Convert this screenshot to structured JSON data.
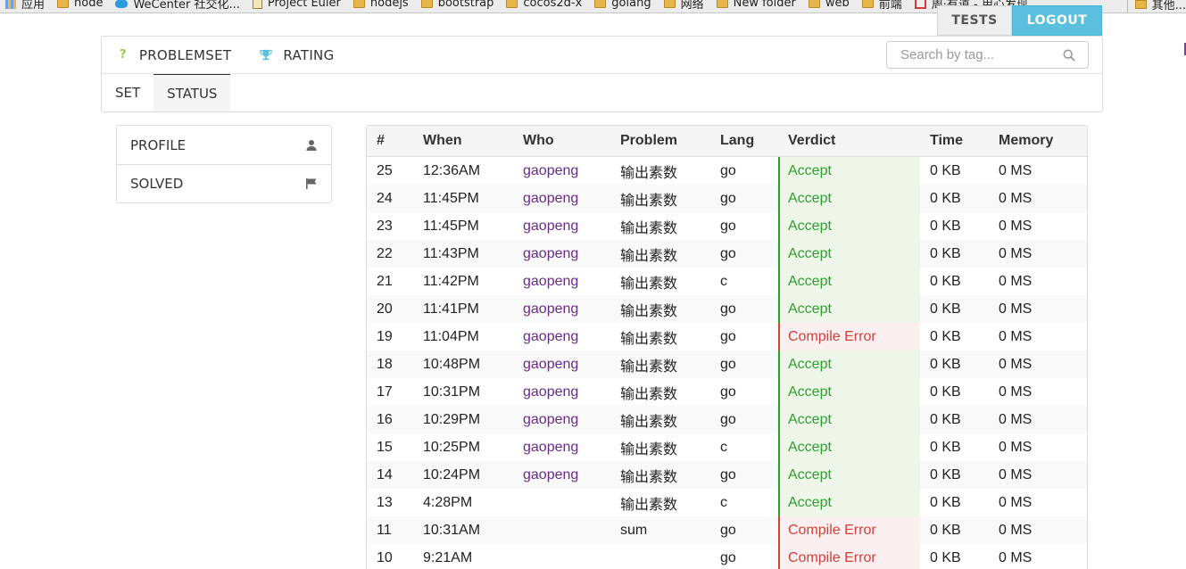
{
  "bookmarks": {
    "items": [
      {
        "label": "应用",
        "icon": "apps-grid-icon"
      },
      {
        "label": "node",
        "icon": "folder-icon"
      },
      {
        "label": "WeCenter 社交化...",
        "icon": "bird-icon"
      },
      {
        "label": "Project Euler",
        "icon": "page-icon"
      },
      {
        "label": "nodejs",
        "icon": "folder-icon"
      },
      {
        "label": "bootstrap",
        "icon": "folder-icon"
      },
      {
        "label": "cocos2d-x",
        "icon": "folder-icon"
      },
      {
        "label": "golang",
        "icon": "folder-icon"
      },
      {
        "label": "网络",
        "icon": "folder-icon"
      },
      {
        "label": "New folder",
        "icon": "folder-icon"
      },
      {
        "label": "web",
        "icon": "folder-icon"
      },
      {
        "label": "前端",
        "icon": "folder-icon"
      },
      {
        "label": "周·有道 - 用心发现...",
        "icon": "red-square-icon"
      }
    ],
    "more": "»",
    "other": "其他..."
  },
  "header": {
    "tests_label": "TESTS",
    "logout_label": "LOGOUT"
  },
  "nav": {
    "problemset_label": "PROBLEMSET",
    "problemset_icon": "question-icon",
    "rating_label": "RATING",
    "rating_icon": "trophy-icon",
    "search_placeholder": "Search by tag...",
    "sub": {
      "set_label": "SET",
      "status_label": "STATUS"
    }
  },
  "sidebar": {
    "profile_label": "PROFILE",
    "profile_icon": "user-icon",
    "solved_label": "SOLVED",
    "solved_icon": "flag-icon"
  },
  "colors": {
    "accept": "#2f9e2f",
    "error": "#d43f3a",
    "logout": "#5bc0de",
    "user": "#6a2a8a"
  },
  "table": {
    "headers": [
      "#",
      "When",
      "Who",
      "Problem",
      "Lang",
      "Verdict",
      "Time",
      "Memory"
    ],
    "rows": [
      {
        "id": "25",
        "when": "12:36AM",
        "who": "gaopeng",
        "problem": "输出素数",
        "lang": "go",
        "verdict": "Accept",
        "status": "ok",
        "time": "0 KB",
        "memory": "0 MS"
      },
      {
        "id": "24",
        "when": "11:45PM",
        "who": "gaopeng",
        "problem": "输出素数",
        "lang": "go",
        "verdict": "Accept",
        "status": "ok",
        "time": "0 KB",
        "memory": "0 MS"
      },
      {
        "id": "23",
        "when": "11:45PM",
        "who": "gaopeng",
        "problem": "输出素数",
        "lang": "go",
        "verdict": "Accept",
        "status": "ok",
        "time": "0 KB",
        "memory": "0 MS"
      },
      {
        "id": "22",
        "when": "11:43PM",
        "who": "gaopeng",
        "problem": "输出素数",
        "lang": "go",
        "verdict": "Accept",
        "status": "ok",
        "time": "0 KB",
        "memory": "0 MS"
      },
      {
        "id": "21",
        "when": "11:42PM",
        "who": "gaopeng",
        "problem": "输出素数",
        "lang": "c",
        "verdict": "Accept",
        "status": "ok",
        "time": "0 KB",
        "memory": "0 MS"
      },
      {
        "id": "20",
        "when": "11:41PM",
        "who": "gaopeng",
        "problem": "输出素数",
        "lang": "go",
        "verdict": "Accept",
        "status": "ok",
        "time": "0 KB",
        "memory": "0 MS"
      },
      {
        "id": "19",
        "when": "11:04PM",
        "who": "gaopeng",
        "problem": "输出素数",
        "lang": "go",
        "verdict": "Compile Error",
        "status": "err",
        "time": "0 KB",
        "memory": "0 MS"
      },
      {
        "id": "18",
        "when": "10:48PM",
        "who": "gaopeng",
        "problem": "输出素数",
        "lang": "go",
        "verdict": "Accept",
        "status": "ok",
        "time": "0 KB",
        "memory": "0 MS"
      },
      {
        "id": "17",
        "when": "10:31PM",
        "who": "gaopeng",
        "problem": "输出素数",
        "lang": "go",
        "verdict": "Accept",
        "status": "ok",
        "time": "0 KB",
        "memory": "0 MS"
      },
      {
        "id": "16",
        "when": "10:29PM",
        "who": "gaopeng",
        "problem": "输出素数",
        "lang": "go",
        "verdict": "Accept",
        "status": "ok",
        "time": "0 KB",
        "memory": "0 MS"
      },
      {
        "id": "15",
        "when": "10:25PM",
        "who": "gaopeng",
        "problem": "输出素数",
        "lang": "c",
        "verdict": "Accept",
        "status": "ok",
        "time": "0 KB",
        "memory": "0 MS"
      },
      {
        "id": "14",
        "when": "10:24PM",
        "who": "gaopeng",
        "problem": "输出素数",
        "lang": "go",
        "verdict": "Accept",
        "status": "ok",
        "time": "0 KB",
        "memory": "0 MS"
      },
      {
        "id": "13",
        "when": "4:28PM",
        "who": "",
        "problem": "输出素数",
        "lang": "c",
        "verdict": "Accept",
        "status": "ok",
        "time": "0 KB",
        "memory": "0 MS"
      },
      {
        "id": "11",
        "when": "10:31AM",
        "who": "",
        "problem": "sum",
        "lang": "go",
        "verdict": "Compile Error",
        "status": "err",
        "time": "0 KB",
        "memory": "0 MS"
      },
      {
        "id": "10",
        "when": "9:21AM",
        "who": "",
        "problem": "",
        "lang": "go",
        "verdict": "Compile Error",
        "status": "err",
        "time": "0 KB",
        "memory": "0 MS"
      }
    ]
  }
}
